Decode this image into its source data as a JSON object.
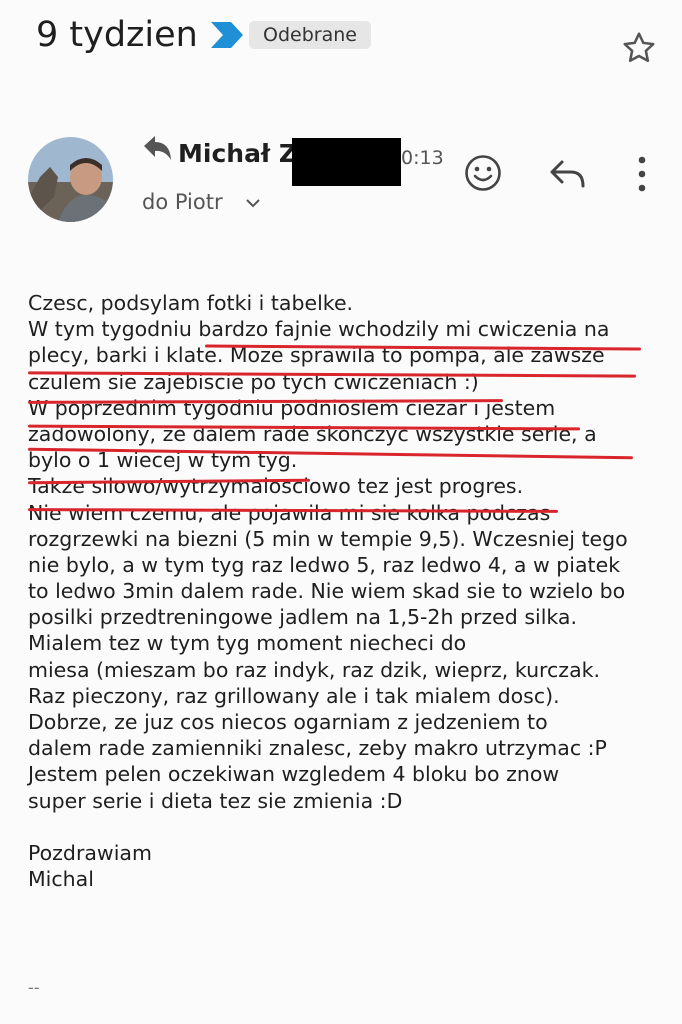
{
  "header": {
    "subject": "9 tydzien",
    "label": "Odebrane"
  },
  "message": {
    "sender": "Michał Z",
    "time": "0:13",
    "to": "do Piotr",
    "body_lines": [
      "Czesc, podsylam fotki i tabelke.",
      "W tym tygodniu bardzo fajnie wchodzily mi cwiczenia na",
      "plecy, barki i klate. Moze sprawila to pompa, ale zawsze",
      "czulem sie zajebiscie po tych cwiczeniach :)",
      "W poprzednim tygodniu podnioslem ciezar i jestem",
      "zadowolony, ze dalem rade skonczyc wszystkie serie, a",
      "bylo o 1 wiecej w tym tyg.",
      "Takze silowo/wytrzymalosciowo tez jest progres.",
      "Nie wiem czemu, ale pojawila mi sie kolka podczas",
      "rozgrzewki na biezni (5 min w tempie 9,5). Wczesniej tego",
      "nie bylo, a w tym tyg raz ledwo 5, raz ledwo 4, a w piatek",
      "to ledwo 3min dalem rade. Nie wiem skad sie to wzielo bo",
      "posilki przedtreningowe jadlem na 1,5-2h przed silka.",
      "Mialem tez w tym tyg moment niecheci do",
      "miesa (mieszam bo raz indyk, raz dzik, wieprz, kurczak.",
      "Raz pieczony, raz grillowany ale i tak mialem dosc).",
      "Dobrze, ze juz cos niecos ogarniam z jedzeniem to",
      "dalem rade zamienniki znalesc, zeby makro utrzymac :P",
      "Jestem pelen oczekiwan wzgledem 4 bloku bo znow",
      "super serie i dieta tez sie zmienia :D",
      "",
      "Pozdrawiam",
      "Michal"
    ],
    "signature_sep": "--"
  },
  "colors": {
    "label_arrow": "#1f8fd6",
    "underline": "#d8262c"
  },
  "icons": [
    "label-arrow-icon",
    "star-icon",
    "reply-icon",
    "emoji-icon",
    "more-icon",
    "chevron-down-icon"
  ]
}
